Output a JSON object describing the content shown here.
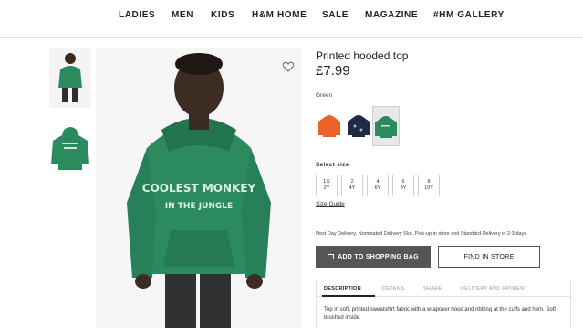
{
  "nav": {
    "items": [
      "LADIES",
      "MEN",
      "KIDS",
      "H&M HOME",
      "SALE",
      "MAGAZINE",
      "#HM GALLERY"
    ]
  },
  "product": {
    "title": "Printed hooded top",
    "price": "£7.99",
    "color_label": "Green",
    "hoodie_print": [
      "COOLEST MONKEY",
      "IN THE JUNGLE"
    ],
    "swatches": [
      {
        "name": "orange",
        "color": "#e8622a"
      },
      {
        "name": "navy",
        "color": "#1f2a44"
      },
      {
        "name": "green",
        "color": "#2b8a5e"
      }
    ],
    "size_label": "Select size",
    "sizes": [
      {
        "top": "1½",
        "bottom": "2Y"
      },
      {
        "top": "2",
        "bottom": "4Y"
      },
      {
        "top": "4",
        "bottom": "6Y"
      },
      {
        "top": "6",
        "bottom": "8Y"
      },
      {
        "top": "8",
        "bottom": "10Y"
      }
    ],
    "size_guide": "Size Guide",
    "delivery_text": "Next Day Delivery, Nominated Delivery Slot, Pick-up in store and Standard Delivery in 2-3 days.",
    "add_to_bag": "ADD TO SHOPPING BAG",
    "find_in_store": "FIND IN STORE",
    "tabs": [
      "DESCRIPTION",
      "DETAILS",
      "SHARE",
      "DELIVERY AND PAYMENT"
    ],
    "description": "Top in soft, printed sweatshirt fabric with a wrapover hood and ribbing at the cuffs and hem. Soft brushed inside."
  },
  "colors": {
    "hoodie_green": "#2b8a5e",
    "button_dark": "#555555"
  }
}
